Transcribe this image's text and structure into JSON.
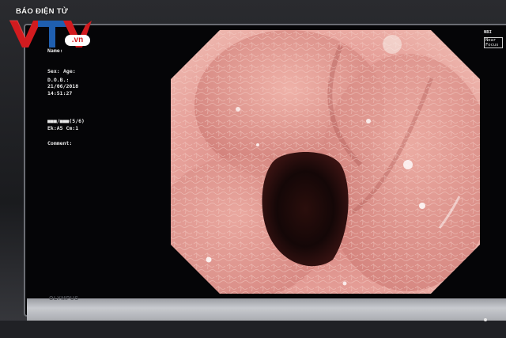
{
  "logo": {
    "caption": "BÁO ĐIỆN TỬ",
    "wordmark": "VTV",
    "domain": ".vn",
    "colors": {
      "v1": "#d21b1f",
      "t": "#1f5fb0",
      "v2": "#d21b1f"
    }
  },
  "patient": {
    "name_label": "Name:",
    "sex_label": "Sex:",
    "age_label": "Age:",
    "dob_label": "D.O.B.:",
    "date": "21/06/2018",
    "time": "14:51:27",
    "image_counter": "■■■/■■■(5/6)",
    "settings": "Ek:A5 Cm:1",
    "comment_label": "Comment:"
  },
  "mode": {
    "light_mode": "NBI",
    "focus_line1": "Near",
    "focus_line2": "Focus"
  },
  "monitor": {
    "brand": "OLYMPUS"
  },
  "scene": {
    "subject": "endoscopic-lumen",
    "tissue_color": "#d9847e",
    "lumen_color": "#120708"
  }
}
